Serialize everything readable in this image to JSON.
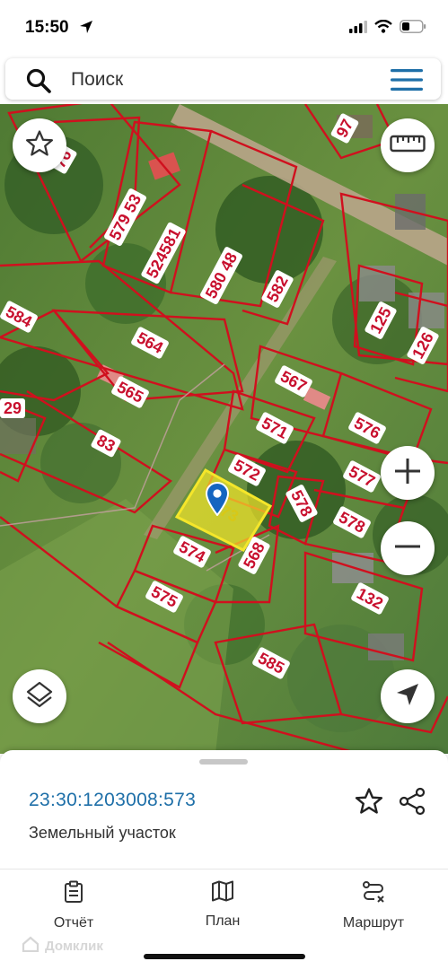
{
  "status_bar": {
    "time": "15:50"
  },
  "search": {
    "placeholder": "Поиск"
  },
  "map": {
    "parcels": [
      "97",
      "76",
      "579 53",
      "524581",
      "580 48",
      "582",
      "584",
      "564",
      "125",
      "126",
      "565",
      "567",
      "29",
      "83",
      "571",
      "576",
      "572",
      "577",
      "573",
      "578",
      "578",
      "574",
      "568",
      "575",
      "132",
      "585"
    ]
  },
  "info": {
    "cadastral_number": "23:30:1203008:573",
    "type": "Земельный участок"
  },
  "nav": {
    "report": "Отчёт",
    "plan": "План",
    "route": "Маршрут"
  },
  "watermark": "Домклик",
  "colors": {
    "accent": "#1e6fa8",
    "parcel_border": "#d0101e",
    "selected_parcel": "#f5e62a"
  }
}
